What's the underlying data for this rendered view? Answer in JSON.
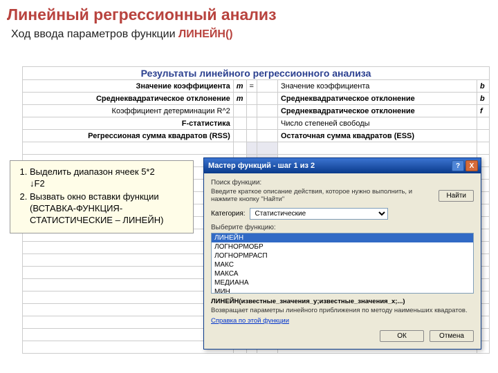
{
  "slide": {
    "title": "Линейный регрессионный анализ",
    "subtitle_prefix": "Ход ввода параметров функции ",
    "subtitle_fn": "ЛИНЕЙН()"
  },
  "sheet": {
    "header": "Результаты линейного регрессионного анализа",
    "rows": [
      {
        "left": "Значение коэффициента",
        "lvar": "m",
        "lsep": "=",
        "right": "Значение коэффициента",
        "rvar": "b"
      },
      {
        "left": "Среднеквадратическое отклонение",
        "lvar": "m",
        "lsep": "",
        "right": "Среднеквадратическое отклонение",
        "rvar": "b"
      },
      {
        "left": "Коэффициент детерминации R^2",
        "lvar": "",
        "lsep": "",
        "right": "Среднеквадратическое отклонение",
        "rvar": "f"
      },
      {
        "left": "F-статистика",
        "lvar": "",
        "lsep": "",
        "right": "Число степеней свободы",
        "rvar": ""
      },
      {
        "left": "Регрессионая сумма квадратов (RSS)",
        "lvar": "",
        "lsep": "",
        "right": "Остаточная сумма квадратов (ESS)",
        "rvar": ""
      }
    ]
  },
  "note": {
    "item1_a": "Выделить диапазон ячеек 5*2",
    "item1_b": "↓F2",
    "item2": "Вызвать окно вставки функции (ВСТАВКА-ФУНКЦИЯ-СТАТИСТИЧЕСКИЕ – ЛИНЕЙН)"
  },
  "wizard": {
    "title": "Мастер функций - шаг 1 из 2",
    "search_label": "Поиск функции:",
    "search_hint": "Введите краткое описание действия, которое нужно выполнить, и нажмите кнопку \"Найти\"",
    "find_btn": "Найти",
    "category_label": "Категория:",
    "category_value": "Статистические",
    "select_label": "Выберите функцию:",
    "functions": [
      "ЛИНЕЙН",
      "ЛОГНОРМОБР",
      "ЛОГНОРМРАСП",
      "МАКС",
      "МАКСА",
      "МЕДИАНА",
      "МИН"
    ],
    "selected_index": 0,
    "signature": "ЛИНЕЙН(известные_значения_y;известные_значения_x;...)",
    "description": "Возвращает параметры линейного приближения по методу наименьших квадратов.",
    "help_link": "Справка по этой функции",
    "ok": "ОК",
    "cancel": "Отмена",
    "help_x": "?",
    "close_x": "X"
  }
}
